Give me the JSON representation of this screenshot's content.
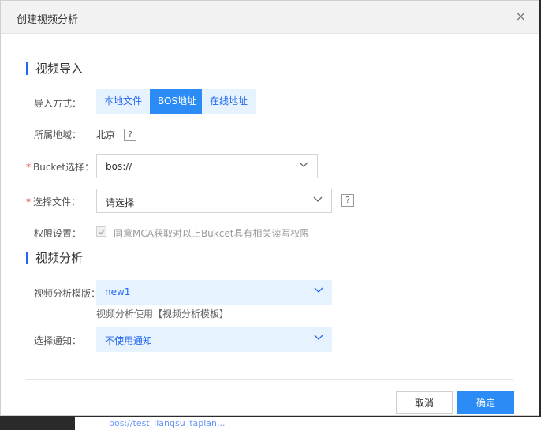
{
  "background": {
    "link_text": "bos://test_lianqsu_taplan..."
  },
  "dialog": {
    "title": "创建视频分析",
    "close_label": "×"
  },
  "import_section": {
    "title": "视频导入",
    "method_label": "导入方式：",
    "methods": [
      "本地文件",
      "BOS地址",
      "在线地址"
    ],
    "selected_method": "BOS地址",
    "region_label": "所属地域：",
    "region_value": "北京",
    "help": "?",
    "bucket_label": "Bucket选择：",
    "bucket_value": "bos://",
    "file_label": "选择文件：",
    "file_value": "请选择",
    "permission_label": "权限设置：",
    "permission_text": "同意MCA获取对以上Bukcet具有相关读写权限",
    "permission_checked": true
  },
  "analysis_section": {
    "title": "视频分析",
    "template_label": "视频分析模版：",
    "template_value": "new1",
    "template_hint": "视频分析使用【视频分析模板】",
    "notify_label": "选择通知：",
    "notify_value": "不使用通知"
  },
  "footer": {
    "cancel_label": "取消",
    "confirm_label": "确定"
  },
  "colors": {
    "accent": "#2b8cf5",
    "required": "#ea2e2e",
    "light_blue": "#e6f2fd"
  }
}
